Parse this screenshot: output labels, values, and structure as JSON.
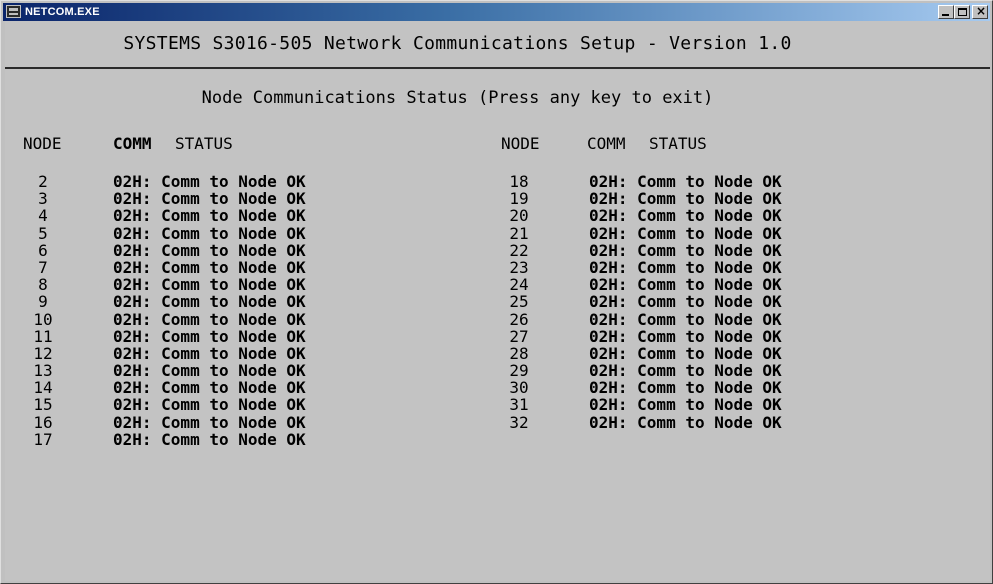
{
  "window": {
    "title": "NETCOM.EXE",
    "close_glyph": "×"
  },
  "screen": {
    "header": "SYSTEMS S3016-505 Network Communications Setup - Version 1.0",
    "status_heading": "Node Communications Status (Press any key to exit)"
  },
  "columns": {
    "left": {
      "node": "NODE",
      "comm": "COMM",
      "status": "STATUS"
    },
    "right": {
      "node": "NODE",
      "comm": "COMM",
      "status": "STATUS"
    }
  },
  "left_rows": [
    {
      "node": "2",
      "status": "02H: Comm to Node OK"
    },
    {
      "node": "3",
      "status": "02H: Comm to Node OK"
    },
    {
      "node": "4",
      "status": "02H: Comm to Node OK"
    },
    {
      "node": "5",
      "status": "02H: Comm to Node OK"
    },
    {
      "node": "6",
      "status": "02H: Comm to Node OK"
    },
    {
      "node": "7",
      "status": "02H: Comm to Node OK"
    },
    {
      "node": "8",
      "status": "02H: Comm to Node OK"
    },
    {
      "node": "9",
      "status": "02H: Comm to Node OK"
    },
    {
      "node": "10",
      "status": "02H: Comm to Node OK"
    },
    {
      "node": "11",
      "status": "02H: Comm to Node OK"
    },
    {
      "node": "12",
      "status": "02H: Comm to Node OK"
    },
    {
      "node": "13",
      "status": "02H: Comm to Node OK"
    },
    {
      "node": "14",
      "status": "02H: Comm to Node OK"
    },
    {
      "node": "15",
      "status": "02H: Comm to Node OK"
    },
    {
      "node": "16",
      "status": "02H: Comm to Node OK"
    },
    {
      "node": "17",
      "status": "02H: Comm to Node OK"
    }
  ],
  "right_rows": [
    {
      "node": "18",
      "status": "02H: Comm to Node OK"
    },
    {
      "node": "19",
      "status": "02H: Comm to Node OK"
    },
    {
      "node": "20",
      "status": "02H: Comm to Node OK"
    },
    {
      "node": "21",
      "status": "02H: Comm to Node OK"
    },
    {
      "node": "22",
      "status": "02H: Comm to Node OK"
    },
    {
      "node": "23",
      "status": "02H: Comm to Node OK"
    },
    {
      "node": "24",
      "status": "02H: Comm to Node OK"
    },
    {
      "node": "25",
      "status": "02H: Comm to Node OK"
    },
    {
      "node": "26",
      "status": "02H: Comm to Node OK"
    },
    {
      "node": "27",
      "status": "02H: Comm to Node OK"
    },
    {
      "node": "28",
      "status": "02H: Comm to Node OK"
    },
    {
      "node": "29",
      "status": "02H: Comm to Node OK"
    },
    {
      "node": "30",
      "status": "02H: Comm to Node OK"
    },
    {
      "node": "31",
      "status": "02H: Comm to Node OK"
    },
    {
      "node": "32",
      "status": "02H: Comm to Node OK"
    }
  ]
}
